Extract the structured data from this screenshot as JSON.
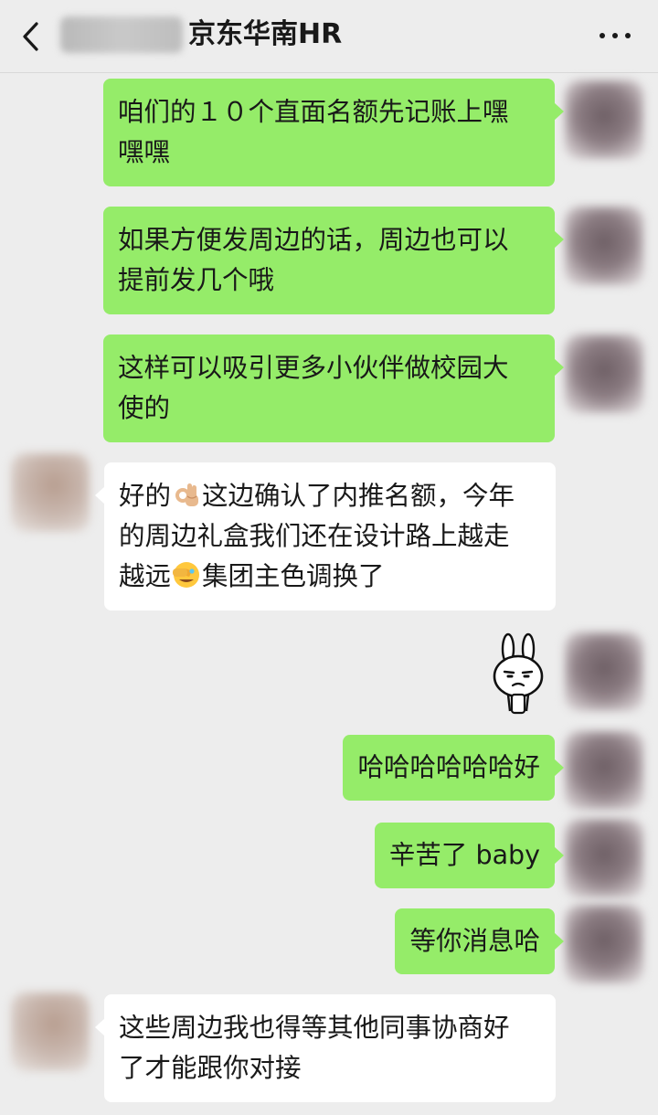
{
  "header": {
    "title": "京东华南HR",
    "back_icon": "chevron-left-icon",
    "more_icon": "more-dots-icon"
  },
  "colors": {
    "sent_bubble": "#95ec69",
    "received_bubble": "#ffffff",
    "background": "#ededed"
  },
  "messages": [
    {
      "from": "me",
      "lines": [
        "咱们的１０个直面名额先记账上嘿",
        "嘿嘿"
      ]
    },
    {
      "from": "me",
      "lines": [
        "如果方便发周边的话，周边也可以",
        "提前发几个哦"
      ]
    },
    {
      "from": "me",
      "lines": [
        "这样可以吸引更多小伙伴做校园大",
        "使的"
      ]
    },
    {
      "from": "them",
      "line1_a": "好的",
      "line1_b": "这边确认了内推名额，今年",
      "line2": "的周边礼盒我们还在设计路上越走",
      "line3_a": "越远",
      "line3_b": "集团主色调换了"
    },
    {
      "from": "me",
      "sticker": "rabbit-sticker"
    },
    {
      "from": "me",
      "lines": [
        "哈哈哈哈哈哈好"
      ]
    },
    {
      "from": "me",
      "lines": [
        "辛苦了 baby"
      ]
    },
    {
      "from": "me",
      "lines": [
        "等你消息哈"
      ]
    },
    {
      "from": "them",
      "lines": [
        "这些周边我也得等其他同事协商好",
        "了才能跟你对接"
      ]
    }
  ]
}
